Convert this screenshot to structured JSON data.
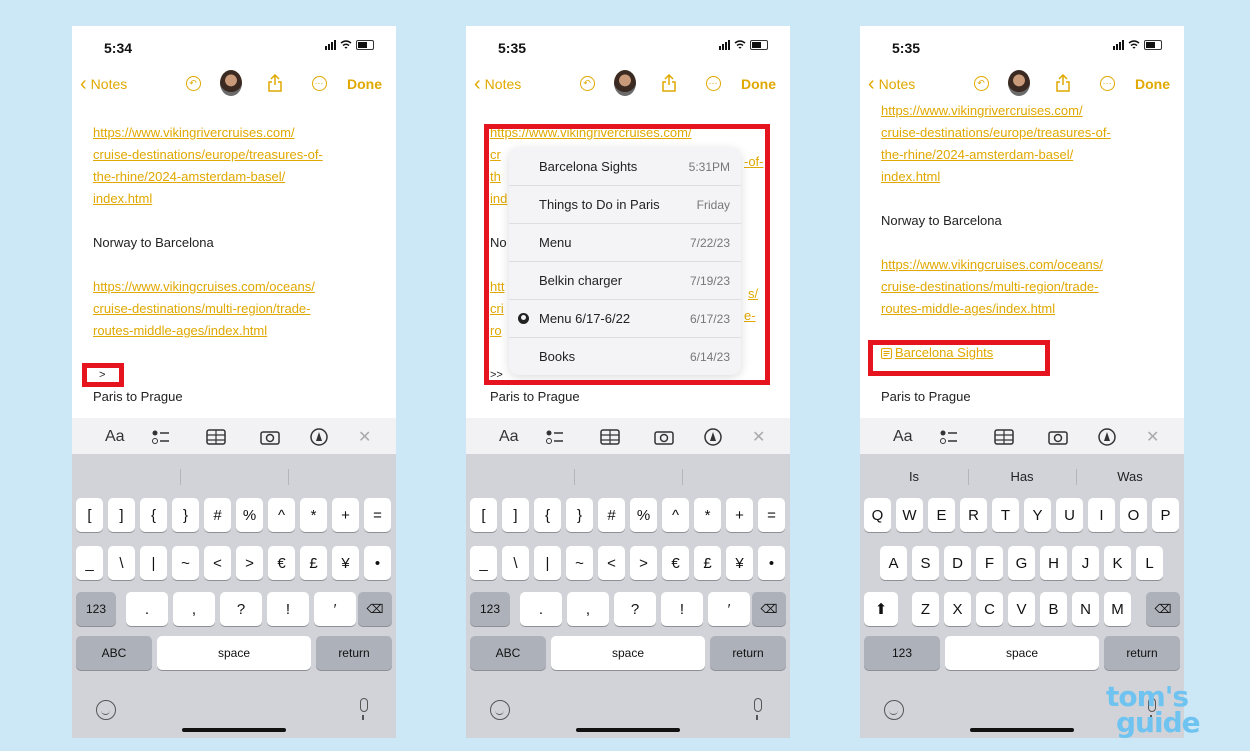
{
  "status": {
    "p1_time": "5:34",
    "p2_time": "5:35",
    "p3_time": "5:35"
  },
  "nav": {
    "back_label": "Notes",
    "done_label": "Done"
  },
  "note": {
    "link1": "https://www.vikingrivercruises.com/cruise-destinations/europe/treasures-of-the-rhine/2024-amsterdam-basel/index.html",
    "link1_lines": [
      "https://www.vikingrivercruises.com/",
      "cruise-destinations/europe/treasures-of-",
      "the-rhine/2024-amsterdam-basel/",
      "index.html"
    ],
    "heading1": "Norway to Barcelona",
    "link2_lines": [
      "https://www.vikingcruises.com/oceans/",
      "cruise-destinations/multi-region/trade-",
      "routes-middle-ages/index.html"
    ],
    "typed_p1": ">",
    "typed_p2": ">>",
    "heading2": "Paris to Prague",
    "linked_note": "Barcelona Sights"
  },
  "p2_partial": {
    "link_top": "https://www.vikingrivercruises.com/",
    "l_cr": "cr",
    "l_th": "th",
    "l_in": "ind",
    "l_no": "No",
    "l_ht": "htt",
    "l_cr2": "cri",
    "l_ro": "ro",
    "r_of": "-of-",
    "r_s": "s/",
    "r_e": "e-"
  },
  "menu": {
    "items": [
      {
        "title": "Barcelona Sights",
        "date": "5:31PM"
      },
      {
        "title": "Things to Do in Paris",
        "date": "Friday"
      },
      {
        "title": "Menu",
        "date": "7/22/23"
      },
      {
        "title": "Belkin charger",
        "date": "7/19/23"
      },
      {
        "title": "Menu 6/17-6/22",
        "date": "6/17/23"
      },
      {
        "title": "Books",
        "date": "6/14/23"
      }
    ]
  },
  "toolbar": {
    "aa": "Aa"
  },
  "suggestions": {
    "p1": [
      "",
      "",
      ""
    ],
    "p3": [
      "Is",
      "Has",
      "Was"
    ]
  },
  "keys_symbols": {
    "row1": [
      "[",
      "]",
      "{",
      "}",
      "#",
      "%",
      "^",
      "*",
      "+",
      "="
    ],
    "row2": [
      "_",
      "\\",
      "|",
      "~",
      "<",
      ">",
      "€",
      "£",
      "¥",
      "•"
    ],
    "row3_mode": "123",
    "row3": [
      ".",
      ",",
      "?",
      "!",
      "′"
    ],
    "abc": "ABC",
    "space": "space",
    "return": "return"
  },
  "keys_letters": {
    "row1": [
      "Q",
      "W",
      "E",
      "R",
      "T",
      "Y",
      "U",
      "I",
      "O",
      "P"
    ],
    "row2": [
      "A",
      "S",
      "D",
      "F",
      "G",
      "H",
      "J",
      "K",
      "L"
    ],
    "row3": [
      "Z",
      "X",
      "C",
      "V",
      "B",
      "N",
      "M"
    ],
    "num": "123",
    "space": "space",
    "return": "return"
  },
  "watermark": {
    "line1": "tom's",
    "line2": "guide"
  },
  "colors": {
    "accent": "#e0a800",
    "highlight_box": "#e6141e",
    "background": "#cce8f7"
  }
}
